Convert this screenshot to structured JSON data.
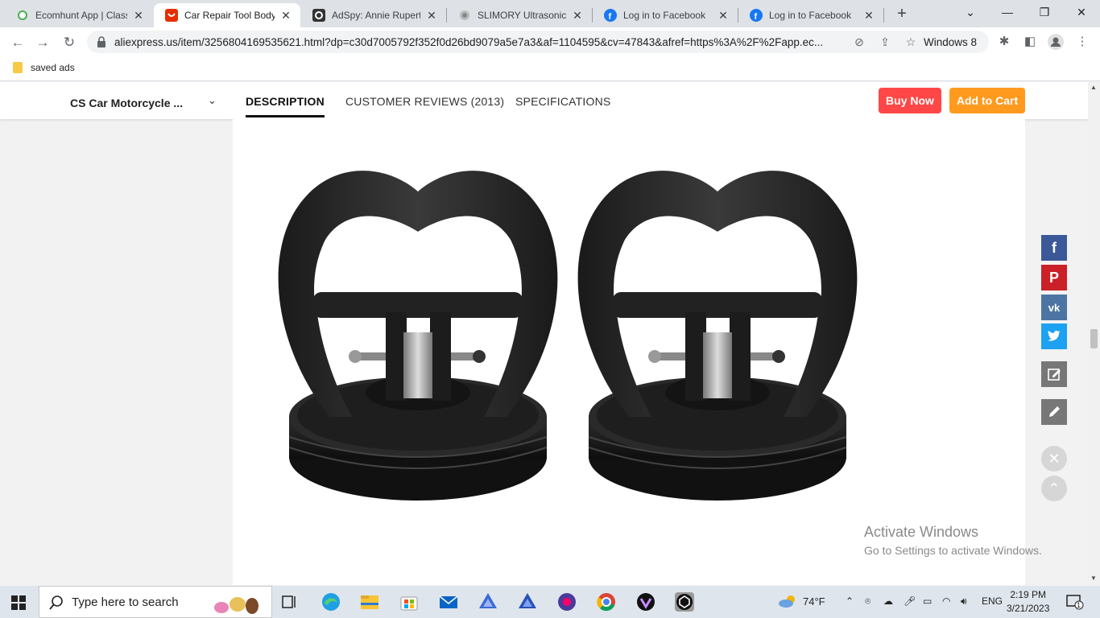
{
  "browser": {
    "tabs": [
      {
        "title": "Ecomhunt App | Classi",
        "icon": "ecomhunt-icon",
        "active": false
      },
      {
        "title": "Car Repair Tool Body F",
        "icon": "aliexpress-icon",
        "active": true
      },
      {
        "title": "AdSpy: Annie Rupert.",
        "icon": "adspy-icon",
        "active": false
      },
      {
        "title": "SLIMORY Ultrasonic Ly",
        "icon": "slimory-icon",
        "active": false
      },
      {
        "title": "Log in to Facebook",
        "icon": "facebook-icon",
        "active": false
      },
      {
        "title": "Log in to Facebook",
        "icon": "facebook-icon",
        "active": false
      }
    ],
    "url": "aliexpress.us/item/3256804169535621.html?dp=c30d7005792f352f0d26bd9079a5e7a3&af=1104595&cv=47843&afref=https%3A%2F%2Fapp.ec...",
    "profile_label": "Windows 8",
    "bookmarks": [
      {
        "label": "saved ads"
      }
    ]
  },
  "page": {
    "product_title": "CS Car Motorcycle ...",
    "tabs": [
      {
        "label": "DESCRIPTION",
        "active": true
      },
      {
        "label": "CUSTOMER REVIEWS (2013)",
        "active": false
      },
      {
        "label": "SPECIFICATIONS",
        "active": false
      }
    ],
    "buy_now": "Buy Now",
    "add_to_cart": "Add to Cart",
    "image_icon": "suction-cup-dent-puller-image"
  },
  "share": [
    "facebook-icon",
    "pinterest-icon",
    "vk-icon",
    "twitter-icon",
    "edit-icon",
    "pencil-icon"
  ],
  "watermark": {
    "title": "Activate Windows",
    "subtitle": "Go to Settings to activate Windows."
  },
  "taskbar": {
    "search_placeholder": "Type here to search",
    "weather": "74°F",
    "language": "ENG",
    "time": "2:19 PM",
    "date": "3/21/2023",
    "notification_count": "1"
  },
  "colors": {
    "buy_now": "#ff4747",
    "add_to_cart": "#ff9a1f",
    "facebook": "#3b5998",
    "pinterest": "#cb2027",
    "vk": "#4c75a3",
    "twitter": "#1da1f2"
  }
}
